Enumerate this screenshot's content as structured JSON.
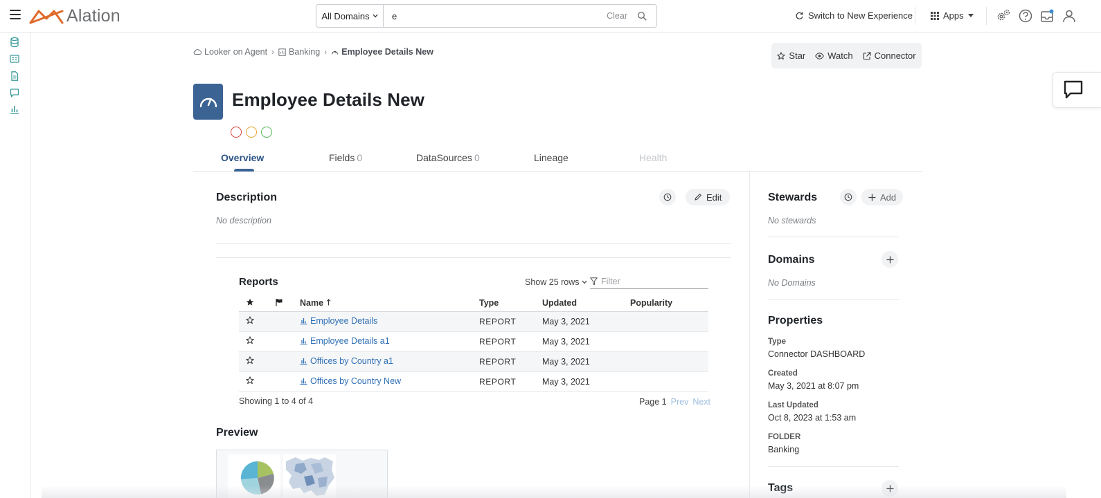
{
  "colors": {
    "brand": "#e06a2b",
    "accent": "#3b6394",
    "link": "#2f6fb5",
    "trust_red": "#d6453d",
    "trust_yellow": "#e6a32b",
    "trust_green": "#55b555"
  },
  "topbar": {
    "logo_text": "Alation",
    "search": {
      "domain_label": "All Domains",
      "value": "e",
      "clear_label": "Clear"
    },
    "switch_label": "Switch to New Experience",
    "apps_label": "Apps"
  },
  "breadcrumb": [
    {
      "label": "Looker on Agent",
      "icon": "cloud-icon"
    },
    {
      "label": "Banking",
      "icon": "folder-icon"
    },
    {
      "label": "Employee Details New",
      "icon": "dashboard-icon"
    }
  ],
  "actions": {
    "star": "Star",
    "watch": "Watch",
    "connector": "Connector"
  },
  "title": "Employee Details New",
  "tabs": [
    {
      "label": "Overview",
      "count": ""
    },
    {
      "label": "Fields",
      "count": "0"
    },
    {
      "label": "DataSources",
      "count": "0"
    },
    {
      "label": "Lineage",
      "count": ""
    },
    {
      "label": "Health",
      "count": ""
    }
  ],
  "description": {
    "title": "Description",
    "empty": "No description",
    "edit_label": "Edit"
  },
  "reports": {
    "title": "Reports",
    "show_rows": "Show 25 rows",
    "filter_placeholder": "Filter",
    "columns": {
      "name": "Name",
      "type": "Type",
      "updated": "Updated",
      "popularity": "Popularity"
    },
    "rows": [
      {
        "name": "Employee Details",
        "type": "REPORT",
        "updated": "May 3, 2021",
        "popularity": ""
      },
      {
        "name": "Employee Details a1",
        "type": "REPORT",
        "updated": "May 3, 2021",
        "popularity": ""
      },
      {
        "name": "Offices by Country a1",
        "type": "REPORT",
        "updated": "May 3, 2021",
        "popularity": ""
      },
      {
        "name": "Offices by Country New",
        "type": "REPORT",
        "updated": "May 3, 2021",
        "popularity": ""
      }
    ],
    "showing": "Showing 1 to 4 of 4",
    "page_label": "Page 1",
    "prev": "Prev",
    "next": "Next"
  },
  "preview": {
    "title": "Preview"
  },
  "stewards": {
    "title": "Stewards",
    "empty": "No stewards",
    "add_label": "Add"
  },
  "domains": {
    "title": "Domains",
    "empty": "No Domains"
  },
  "properties": {
    "title": "Properties",
    "items": [
      {
        "label": "Type",
        "value": "Connector DASHBOARD"
      },
      {
        "label": "Created",
        "value": "May 3, 2021 at 8:07 pm"
      },
      {
        "label": "Last Updated",
        "value": "Oct 8, 2023 at 1:53 am"
      },
      {
        "label": "FOLDER",
        "value": "Banking"
      }
    ]
  },
  "tags": {
    "title": "Tags"
  }
}
